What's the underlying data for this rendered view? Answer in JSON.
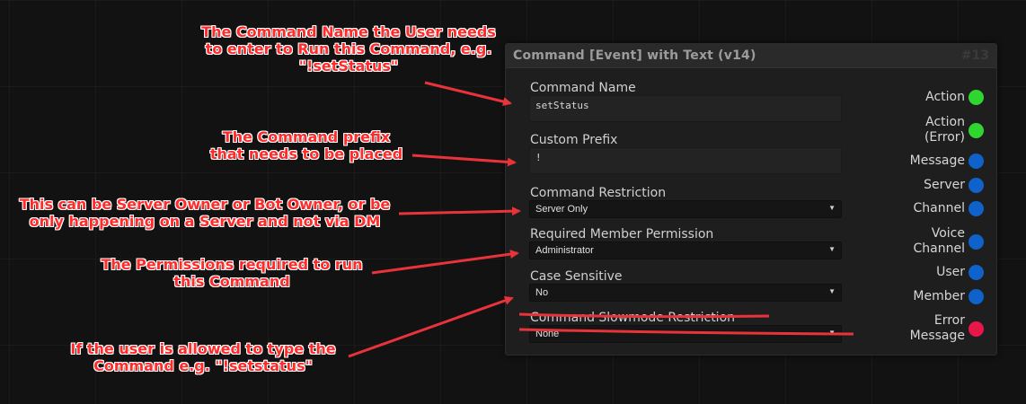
{
  "node": {
    "title": "Command [Event] with Text (v14)",
    "id": "#13",
    "fields": {
      "command_name": {
        "label": "Command Name",
        "value": "setStatus"
      },
      "custom_prefix": {
        "label": "Custom Prefix",
        "value": "!"
      },
      "command_restriction": {
        "label": "Command Restriction",
        "value": "Server Only"
      },
      "required_permission": {
        "label": "Required Member Permission",
        "value": "Administrator"
      },
      "case_sensitive": {
        "label": "Case Sensitive",
        "value": "No"
      },
      "slowmode": {
        "label": "Command Slowmode Restriction",
        "value": "None"
      }
    },
    "outputs": [
      {
        "label": "Action",
        "color": "#2fd62f"
      },
      {
        "label": "Action (Error)",
        "color": "#2fd62f"
      },
      {
        "label": "Message",
        "color": "#0f62c9"
      },
      {
        "label": "Server",
        "color": "#0f62c9"
      },
      {
        "label": "Channel",
        "color": "#0f62c9"
      },
      {
        "label": "Voice Channel",
        "color": "#0f62c9"
      },
      {
        "label": "User",
        "color": "#0f62c9"
      },
      {
        "label": "Member",
        "color": "#0f62c9"
      },
      {
        "label": "Error Message",
        "color": "#e8174a"
      }
    ],
    "output_lines": {
      "action_error": [
        "Action",
        "(Error)"
      ],
      "voice_channel": [
        "Voice",
        "Channel"
      ],
      "error_message": [
        "Error",
        "Message"
      ]
    }
  },
  "annotations": {
    "command_name": [
      "The Command Name the User needs",
      "to enter to Run this Command, e.g.",
      "\"!setStatus\""
    ],
    "prefix": [
      "The Command prefix",
      "that needs to be placed"
    ],
    "restriction": [
      "This can be Server Owner or Bot Owner, or be",
      "only happening on a Server and not via DM"
    ],
    "permission": [
      "The Permissions required to run",
      "this Command"
    ],
    "case": [
      "If the user is allowed to type the",
      "Command e.g. \"!setstatus\""
    ]
  },
  "colors": {
    "annotation": "#ff2a2a",
    "arrow": "#e8333a"
  }
}
